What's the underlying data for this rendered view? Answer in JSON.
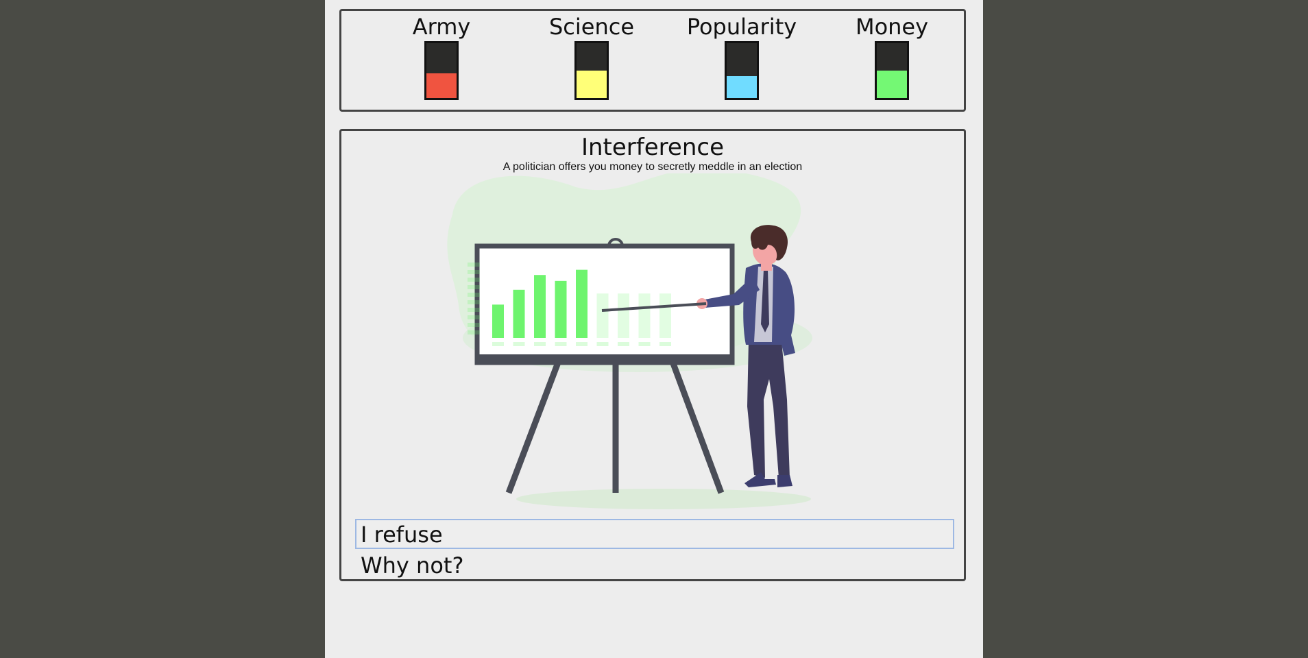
{
  "stats": [
    {
      "label": "Army",
      "level": 0.45,
      "color": "#f05440"
    },
    {
      "label": "Science",
      "level": 0.5,
      "color": "#ffff78"
    },
    {
      "label": "Popularity",
      "level": 0.4,
      "color": "#70dcff"
    },
    {
      "label": "Money",
      "level": 0.5,
      "color": "#74f874"
    }
  ],
  "event": {
    "title": "Interference",
    "description": "A politician offers you money to secretly meddle in an election",
    "illustration": "presenter-chart-illustration"
  },
  "choices": [
    {
      "label": "I refuse"
    },
    {
      "label": "Why not?"
    }
  ],
  "illustration_chart": {
    "solid_bars": [
      0.45,
      0.65,
      0.85,
      0.77,
      0.92
    ],
    "faded_bars": [
      0.6,
      0.6,
      0.6,
      0.6
    ],
    "accent": "#6ef46e"
  }
}
